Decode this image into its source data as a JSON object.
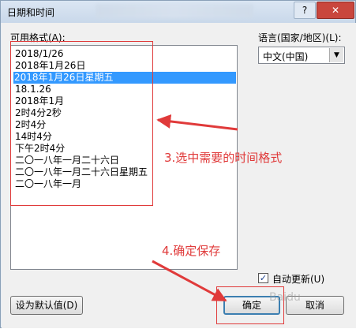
{
  "window": {
    "title": "日期和时间",
    "help_label": "?",
    "close_label": "✕"
  },
  "formats": {
    "label": "可用格式(A):",
    "items": [
      "2018/1/26",
      "2018年1月26日",
      "2018年1月26日星期五",
      "18.1.26",
      "2018年1月",
      "2时4分2秒",
      "2时4分",
      "14时4分",
      "下午2时4分",
      "二〇一八年一月二十六日",
      "二〇一八年一月二十六日星期五",
      "二〇一八年一月"
    ],
    "selected_index": 2
  },
  "language": {
    "label": "语言(国家/地区)(L):",
    "value": "中文(中国)",
    "arrow": "▼"
  },
  "auto_update": {
    "label": "自动更新(U)",
    "checked": true,
    "mark": "✓"
  },
  "buttons": {
    "default": "设为默认值(D)",
    "ok": "确定",
    "cancel": "取消"
  },
  "annotations": {
    "step3": "3.选中需要的时间格式",
    "step4": "4.确定保存",
    "color": "#e03a3a"
  },
  "watermark": "Baidu"
}
